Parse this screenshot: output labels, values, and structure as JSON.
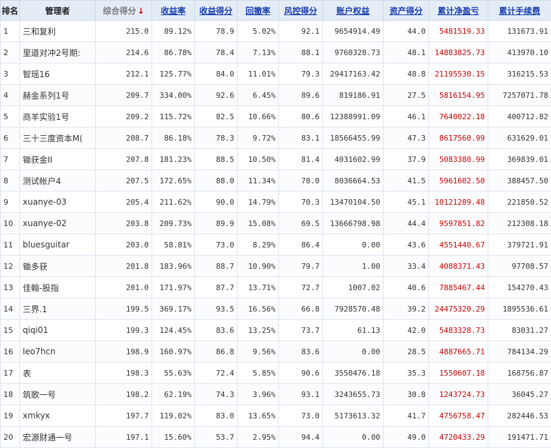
{
  "headers": {
    "rank": "排名",
    "manager": "管理者",
    "composite": "综合得分",
    "sort_arrow": "↓",
    "return_rate": "收益率",
    "return_score": "收益得分",
    "drawdown": "回撤率",
    "risk_score": "风控得分",
    "equity": "账户权益",
    "asset_score": "资产得分",
    "cum_pnl": "累计净盈亏",
    "cum_fee": "累计手续费"
  },
  "colors": {
    "header_bg": "#e4ecf6",
    "link": "#1a3fb0",
    "red": "#cc0000",
    "arrow": "#d00000"
  },
  "rows": [
    [
      "1",
      "三和复利",
      "215.0",
      "89.12%",
      "78.9",
      "5.02%",
      "92.1",
      "9654914.49",
      "44.0",
      "5481519.33",
      "131673.91"
    ],
    [
      "2",
      "里道对冲2号期:",
      "214.6",
      "86.78%",
      "78.4",
      "7.13%",
      "88.1",
      "9760328.73",
      "48.1",
      "14883825.73",
      "413970.10"
    ],
    [
      "3",
      "智瑶16",
      "212.1",
      "125.77%",
      "84.0",
      "11.01%",
      "79.3",
      "29417163.42",
      "48.8",
      "21195530.15",
      "316215.53"
    ],
    [
      "4",
      "赫金系列1号",
      "209.7",
      "334.00%",
      "92.6",
      "6.45%",
      "89.6",
      "819186.91",
      "27.5",
      "5816154.95",
      "7257071.78"
    ],
    [
      "5",
      "商羊实验1号",
      "209.2",
      "115.72%",
      "82.5",
      "10.66%",
      "80.6",
      "12388991.09",
      "46.1",
      "7640022.18",
      "400712.82"
    ],
    [
      "6",
      "三十三度资本M(",
      "208.7",
      "86.18%",
      "78.3",
      "9.72%",
      "83.1",
      "18566455.99",
      "47.3",
      "8617560.99",
      "631629.01"
    ],
    [
      "7",
      "锄获金II",
      "207.8",
      "181.23%",
      "88.5",
      "10.50%",
      "81.4",
      "4031602.99",
      "37.9",
      "5083380.99",
      "369839.01"
    ],
    [
      "8",
      "测试帐户4",
      "207.5",
      "172.65%",
      "88.0",
      "11.34%",
      "78.0",
      "8036664.53",
      "41.5",
      "5961602.50",
      "388457.50"
    ],
    [
      "9",
      "xuanye-03",
      "205.4",
      "211.62%",
      "90.0",
      "14.79%",
      "70.3",
      "13470104.50",
      "45.1",
      "10121289.48",
      "221850.52"
    ],
    [
      "10",
      "xuanye-02",
      "203.8",
      "209.73%",
      "89.9",
      "15.08%",
      "69.5",
      "13666798.98",
      "44.4",
      "9597851.82",
      "212308.18"
    ],
    [
      "11",
      "bluesguitar",
      "203.0",
      "58.81%",
      "73.0",
      "8.29%",
      "86.4",
      "0.00",
      "43.6",
      "4551440.67",
      "379721.91"
    ],
    [
      "12",
      "锄多获",
      "201.8",
      "183.96%",
      "88.7",
      "10.90%",
      "79.7",
      "1.00",
      "33.4",
      "4088371.43",
      "97708.57"
    ],
    [
      "13",
      "佳翰-股指",
      "201.0",
      "171.97%",
      "87.7",
      "13.71%",
      "72.7",
      "1007.02",
      "40.6",
      "7885467.44",
      "154270.43"
    ],
    [
      "14",
      "三界.1",
      "199.5",
      "369.17%",
      "93.5",
      "16.56%",
      "66.8",
      "7928570.48",
      "39.2",
      "24475320.29",
      "1895536.61"
    ],
    [
      "15",
      "qiqi01",
      "199.3",
      "124.45%",
      "83.6",
      "13.25%",
      "73.7",
      "61.13",
      "42.0",
      "5483328.73",
      "83031.27"
    ],
    [
      "16",
      "leo7hcn",
      "198.9",
      "160.97%",
      "86.8",
      "9.56%",
      "83.6",
      "0.00",
      "28.5",
      "4887665.71",
      "784134.29"
    ],
    [
      "17",
      "表",
      "198.3",
      "55.63%",
      "72.4",
      "5.85%",
      "90.6",
      "3550476.18",
      "35.3",
      "1550607.18",
      "168756.87"
    ],
    [
      "18",
      "筑歌一号",
      "198.2",
      "62.19%",
      "74.3",
      "3.96%",
      "93.1",
      "3243655.73",
      "30.8",
      "1243724.73",
      "36045.27"
    ],
    [
      "19",
      "xmkyx",
      "197.7",
      "119.02%",
      "83.0",
      "13.65%",
      "73.0",
      "5173613.32",
      "41.7",
      "4756758.47",
      "282446.53"
    ],
    [
      "20",
      "宏源财通一号",
      "197.1",
      "15.60%",
      "53.7",
      "2.95%",
      "94.4",
      "0.00",
      "49.0",
      "4720433.29",
      "191471.71"
    ]
  ]
}
